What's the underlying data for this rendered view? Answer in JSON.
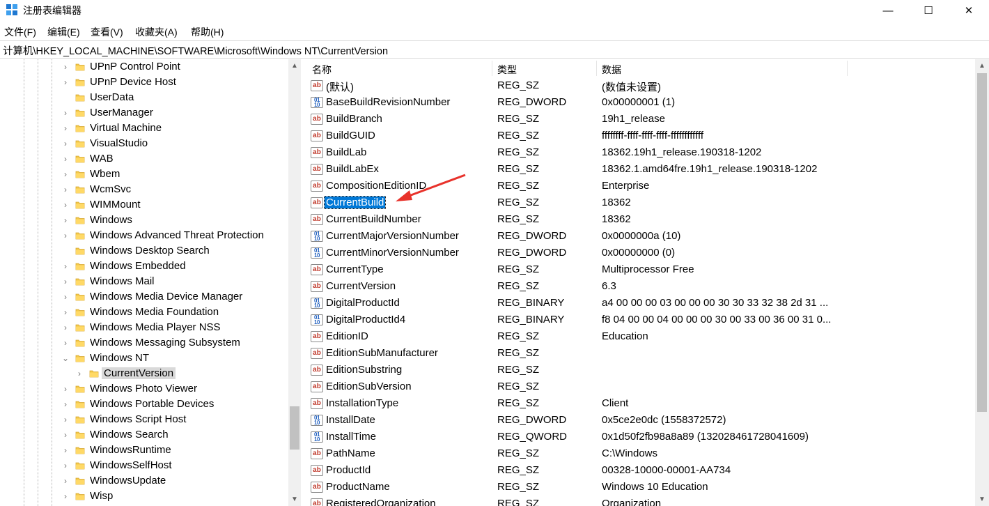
{
  "window": {
    "title": "注册表编辑器",
    "buttons": {
      "minimize": "—",
      "maximize": "☐",
      "close": "✕"
    }
  },
  "menu": [
    "文件(F)",
    "编辑(E)",
    "查看(V)",
    "收藏夹(A)",
    "帮助(H)"
  ],
  "address": "计算机\\HKEY_LOCAL_MACHINE\\SOFTWARE\\Microsoft\\Windows NT\\CurrentVersion",
  "tree": {
    "items": [
      {
        "label": "UPnP Control Point",
        "expander": "›"
      },
      {
        "label": "UPnP Device Host",
        "expander": "›"
      },
      {
        "label": "UserData",
        "expander": ""
      },
      {
        "label": "UserManager",
        "expander": "›"
      },
      {
        "label": "Virtual Machine",
        "expander": "›"
      },
      {
        "label": "VisualStudio",
        "expander": "›"
      },
      {
        "label": "WAB",
        "expander": "›"
      },
      {
        "label": "Wbem",
        "expander": "›"
      },
      {
        "label": "WcmSvc",
        "expander": "›"
      },
      {
        "label": "WIMMount",
        "expander": "›"
      },
      {
        "label": "Windows",
        "expander": "›"
      },
      {
        "label": "Windows Advanced Threat Protection",
        "expander": "›"
      },
      {
        "label": "Windows Desktop Search",
        "expander": ""
      },
      {
        "label": "Windows Embedded",
        "expander": "›"
      },
      {
        "label": "Windows Mail",
        "expander": "›"
      },
      {
        "label": "Windows Media Device Manager",
        "expander": "›"
      },
      {
        "label": "Windows Media Foundation",
        "expander": "›"
      },
      {
        "label": "Windows Media Player NSS",
        "expander": "›"
      },
      {
        "label": "Windows Messaging Subsystem",
        "expander": "›"
      },
      {
        "label": "Windows NT",
        "expander": "⌄"
      },
      {
        "label": "CurrentVersion",
        "expander": "›",
        "child": true,
        "selected": true
      },
      {
        "label": "Windows Photo Viewer",
        "expander": "›"
      },
      {
        "label": "Windows Portable Devices",
        "expander": "›"
      },
      {
        "label": "Windows Script Host",
        "expander": "›"
      },
      {
        "label": "Windows Search",
        "expander": "›"
      },
      {
        "label": "WindowsRuntime",
        "expander": "›"
      },
      {
        "label": "WindowsSelfHost",
        "expander": "›"
      },
      {
        "label": "WindowsUpdate",
        "expander": "›"
      },
      {
        "label": "Wisp",
        "expander": "›"
      }
    ]
  },
  "list": {
    "columns": {
      "name": "名称",
      "type": "类型",
      "data": "数据"
    },
    "rows": [
      {
        "icon": "string-value-icon",
        "name": "(默认)",
        "type": "REG_SZ",
        "data": "(数值未设置)"
      },
      {
        "icon": "binary-value-icon",
        "name": "BaseBuildRevisionNumber",
        "type": "REG_DWORD",
        "data": "0x00000001 (1)"
      },
      {
        "icon": "string-value-icon",
        "name": "BuildBranch",
        "type": "REG_SZ",
        "data": "19h1_release"
      },
      {
        "icon": "string-value-icon",
        "name": "BuildGUID",
        "type": "REG_SZ",
        "data": "ffffffff-ffff-ffff-ffff-ffffffffffff"
      },
      {
        "icon": "string-value-icon",
        "name": "BuildLab",
        "type": "REG_SZ",
        "data": "18362.19h1_release.190318-1202"
      },
      {
        "icon": "string-value-icon",
        "name": "BuildLabEx",
        "type": "REG_SZ",
        "data": "18362.1.amd64fre.19h1_release.190318-1202"
      },
      {
        "icon": "string-value-icon",
        "name": "CompositionEditionID",
        "type": "REG_SZ",
        "data": "Enterprise"
      },
      {
        "icon": "string-value-icon",
        "name": "CurrentBuild",
        "type": "REG_SZ",
        "data": "18362",
        "selected": true
      },
      {
        "icon": "string-value-icon",
        "name": "CurrentBuildNumber",
        "type": "REG_SZ",
        "data": "18362"
      },
      {
        "icon": "binary-value-icon",
        "name": "CurrentMajorVersionNumber",
        "type": "REG_DWORD",
        "data": "0x0000000a (10)"
      },
      {
        "icon": "binary-value-icon",
        "name": "CurrentMinorVersionNumber",
        "type": "REG_DWORD",
        "data": "0x00000000 (0)"
      },
      {
        "icon": "string-value-icon",
        "name": "CurrentType",
        "type": "REG_SZ",
        "data": "Multiprocessor Free"
      },
      {
        "icon": "string-value-icon",
        "name": "CurrentVersion",
        "type": "REG_SZ",
        "data": "6.3"
      },
      {
        "icon": "binary-value-icon",
        "name": "DigitalProductId",
        "type": "REG_BINARY",
        "data": "a4 00 00 00 03 00 00 00 30 30 33 32 38 2d 31 ..."
      },
      {
        "icon": "binary-value-icon",
        "name": "DigitalProductId4",
        "type": "REG_BINARY",
        "data": "f8 04 00 00 04 00 00 00 30 00 33 00 36 00 31 0..."
      },
      {
        "icon": "string-value-icon",
        "name": "EditionID",
        "type": "REG_SZ",
        "data": "Education"
      },
      {
        "icon": "string-value-icon",
        "name": "EditionSubManufacturer",
        "type": "REG_SZ",
        "data": ""
      },
      {
        "icon": "string-value-icon",
        "name": "EditionSubstring",
        "type": "REG_SZ",
        "data": ""
      },
      {
        "icon": "string-value-icon",
        "name": "EditionSubVersion",
        "type": "REG_SZ",
        "data": ""
      },
      {
        "icon": "string-value-icon",
        "name": "InstallationType",
        "type": "REG_SZ",
        "data": "Client"
      },
      {
        "icon": "binary-value-icon",
        "name": "InstallDate",
        "type": "REG_DWORD",
        "data": "0x5ce2e0dc (1558372572)"
      },
      {
        "icon": "binary-value-icon",
        "name": "InstallTime",
        "type": "REG_QWORD",
        "data": "0x1d50f2fb98a8a89 (132028461728041609)"
      },
      {
        "icon": "string-value-icon",
        "name": "PathName",
        "type": "REG_SZ",
        "data": "C:\\Windows"
      },
      {
        "icon": "string-value-icon",
        "name": "ProductId",
        "type": "REG_SZ",
        "data": "00328-10000-00001-AA734"
      },
      {
        "icon": "string-value-icon",
        "name": "ProductName",
        "type": "REG_SZ",
        "data": "Windows 10 Education"
      },
      {
        "icon": "string-value-icon",
        "name": "RegisteredOrganization",
        "type": "REG_SZ",
        "data": "Organization"
      }
    ]
  },
  "annotation_color": "#e8322b"
}
